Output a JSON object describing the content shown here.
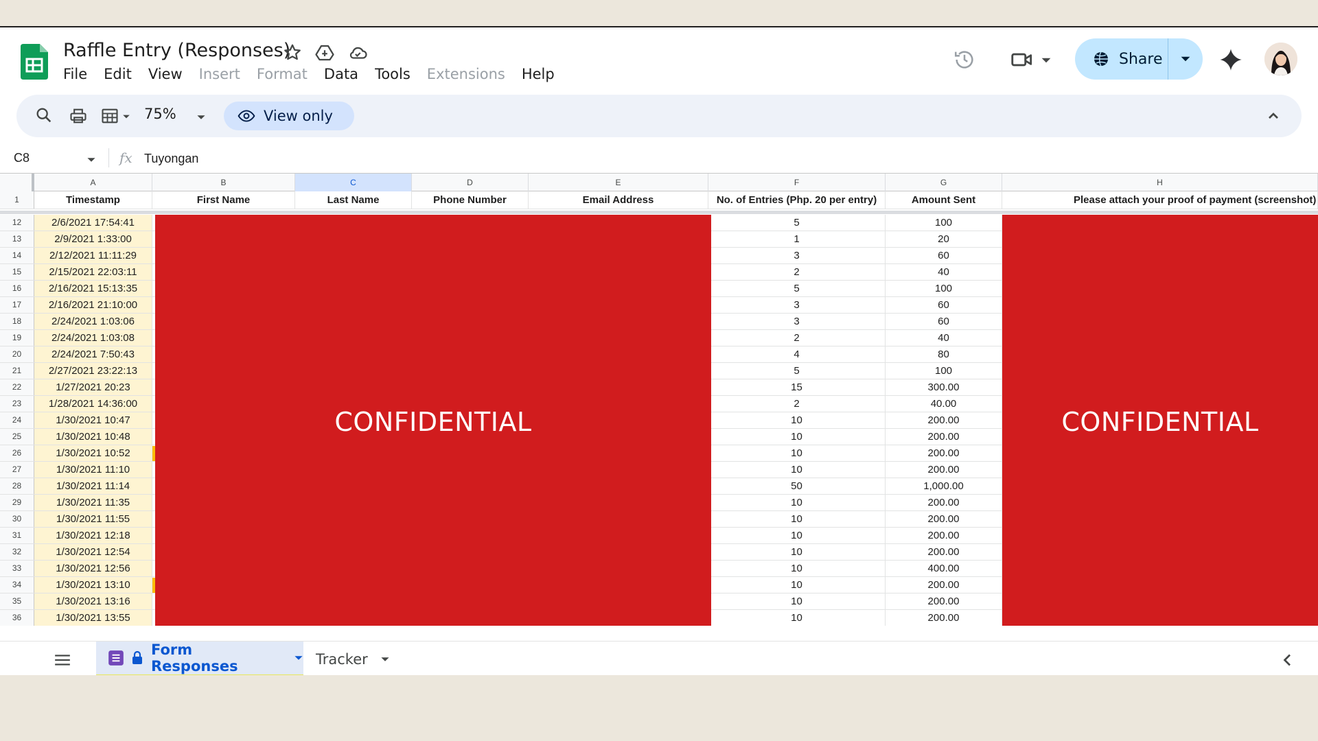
{
  "app": {
    "doc_title": "Raffle Entry (Responses)",
    "menus": [
      {
        "label": "File",
        "disabled": false
      },
      {
        "label": "Edit",
        "disabled": false
      },
      {
        "label": "View",
        "disabled": false
      },
      {
        "label": "Insert",
        "disabled": true
      },
      {
        "label": "Format",
        "disabled": true
      },
      {
        "label": "Data",
        "disabled": false
      },
      {
        "label": "Tools",
        "disabled": false
      },
      {
        "label": "Extensions",
        "disabled": true
      },
      {
        "label": "Help",
        "disabled": false
      }
    ],
    "share_label": "Share",
    "accent": "#c2e7ff"
  },
  "toolbar": {
    "zoom": "75%",
    "view_only_label": "View only"
  },
  "formula_bar": {
    "cell_ref": "C8",
    "fx": "fx",
    "value": "Tuyongan"
  },
  "sheet": {
    "column_letters": [
      "A",
      "B",
      "C",
      "D",
      "E",
      "F",
      "G",
      "H"
    ],
    "selected_column": "C",
    "header_row_number": "1",
    "headers": [
      "Timestamp",
      "First Name",
      "Last Name",
      "Phone Number",
      "Email Address",
      "No. of Entries (Php. 20 per entry)",
      "Amount Sent",
      "Please attach your proof of payment (screenshot)"
    ],
    "rows": [
      {
        "n": "12",
        "ts": "2/6/2021 17:54:41",
        "entries": "5",
        "amount": "100"
      },
      {
        "n": "13",
        "ts": "2/9/2021 1:33:00",
        "entries": "1",
        "amount": "20"
      },
      {
        "n": "14",
        "ts": "2/12/2021 11:11:29",
        "entries": "3",
        "amount": "60"
      },
      {
        "n": "15",
        "ts": "2/15/2021 22:03:11",
        "entries": "2",
        "amount": "40"
      },
      {
        "n": "16",
        "ts": "2/16/2021 15:13:35",
        "entries": "5",
        "amount": "100"
      },
      {
        "n": "17",
        "ts": "2/16/2021 21:10:00",
        "entries": "3",
        "amount": "60"
      },
      {
        "n": "18",
        "ts": "2/24/2021 1:03:06",
        "entries": "3",
        "amount": "60"
      },
      {
        "n": "19",
        "ts": "2/24/2021 1:03:08",
        "entries": "2",
        "amount": "40"
      },
      {
        "n": "20",
        "ts": "2/24/2021 7:50:43",
        "entries": "4",
        "amount": "80"
      },
      {
        "n": "21",
        "ts": "2/27/2021 23:22:13",
        "entries": "5",
        "amount": "100"
      },
      {
        "n": "22",
        "ts": "1/27/2021 20:23",
        "entries": "15",
        "amount": "300.00"
      },
      {
        "n": "23",
        "ts": "1/28/2021 14:36:00",
        "entries": "2",
        "amount": "40.00"
      },
      {
        "n": "24",
        "ts": "1/30/2021 10:47",
        "entries": "10",
        "amount": "200.00"
      },
      {
        "n": "25",
        "ts": "1/30/2021 10:48",
        "entries": "10",
        "amount": "200.00"
      },
      {
        "n": "26",
        "ts": "1/30/2021 10:52",
        "entries": "10",
        "amount": "200.00",
        "marked": true
      },
      {
        "n": "27",
        "ts": "1/30/2021 11:10",
        "entries": "10",
        "amount": "200.00"
      },
      {
        "n": "28",
        "ts": "1/30/2021 11:14",
        "entries": "50",
        "amount": "1,000.00"
      },
      {
        "n": "29",
        "ts": "1/30/2021 11:35",
        "entries": "10",
        "amount": "200.00"
      },
      {
        "n": "30",
        "ts": "1/30/2021 11:55",
        "entries": "10",
        "amount": "200.00"
      },
      {
        "n": "31",
        "ts": "1/30/2021 12:18",
        "entries": "10",
        "amount": "200.00"
      },
      {
        "n": "32",
        "ts": "1/30/2021 12:54",
        "entries": "10",
        "amount": "200.00"
      },
      {
        "n": "33",
        "ts": "1/30/2021 12:56",
        "entries": "10",
        "amount": "400.00"
      },
      {
        "n": "34",
        "ts": "1/30/2021 13:10",
        "entries": "10",
        "amount": "200.00",
        "marked": true
      },
      {
        "n": "35",
        "ts": "1/30/2021 13:16",
        "entries": "10",
        "amount": "200.00"
      },
      {
        "n": "36",
        "ts": "1/30/2021 13:55",
        "entries": "10",
        "amount": "200.00"
      }
    ],
    "redaction_text": "CONFIDENTIAL",
    "redaction_color": "#d11c1e",
    "timestamp_fill": "#fef4d2"
  },
  "tabs": {
    "active": "Form Responses",
    "other": "Tracker"
  }
}
